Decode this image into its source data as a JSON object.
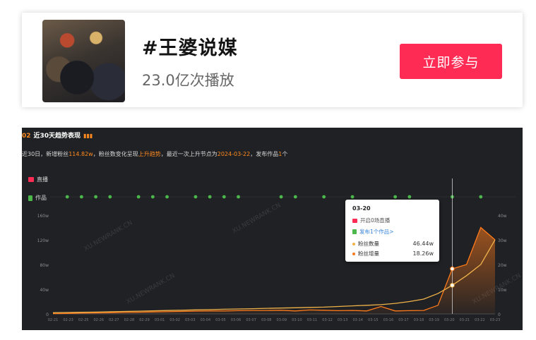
{
  "topic": {
    "title": "#王婆说媒",
    "views": "23.0亿次播放",
    "join_label": "立即参与"
  },
  "trend": {
    "section_number": "02",
    "section_title": "近30天趋势表现",
    "summary": {
      "p1": "近30日，新增粉丝",
      "fans_added": "114.82w",
      "p2": "，粉丝数变化呈现",
      "trend_word": "上升趋势",
      "p3": "，最近一次上升节点为",
      "last_rise": "2024-03-22",
      "p4": "，发布作品",
      "works_count": "1",
      "p5": "个"
    },
    "legend_live": "直播",
    "legend_works": "作品",
    "tooltip": {
      "date": "03-20",
      "live": "开启0场直播",
      "works": "发布1个作品>",
      "fans_label": "粉丝数量",
      "fans_value": "46.44w",
      "inc_label": "粉丝增量",
      "inc_value": "18.26w"
    },
    "watermark": "XU.NEWRANK.CN"
  },
  "chart_data": {
    "type": "line",
    "x": [
      "02-21",
      "02-22",
      "02-23",
      "02-24",
      "02-25",
      "02-26",
      "02-27",
      "02-28",
      "02-29",
      "03-01",
      "03-02",
      "03-03",
      "03-04",
      "03-05",
      "03-06",
      "03-07",
      "03-08",
      "03-09",
      "03-10",
      "03-11",
      "03-12",
      "03-13",
      "03-14",
      "03-15",
      "03-16",
      "03-17",
      "03-18",
      "03-19",
      "03-20",
      "03-21",
      "03-22",
      "03-23"
    ],
    "x_tick_labels": [
      "02-21",
      "02-23",
      "02-25",
      "02-26",
      "02-27",
      "02-28",
      "02-29",
      "03-01",
      "03-02",
      "03-03",
      "03-04",
      "03-05",
      "03-06",
      "03-07",
      "03-08",
      "03-09",
      "03-10",
      "03-11",
      "03-12",
      "03-13",
      "03-14",
      "03-15",
      "03-16",
      "03-17",
      "03-18",
      "03-19",
      "03-20",
      "03-21",
      "03-22",
      "03-23"
    ],
    "y_left_ticks": [
      "160w",
      "120w",
      "80w",
      "40w",
      "0"
    ],
    "y_right_ticks": [
      "40w",
      "30w",
      "20w",
      "10w",
      "0"
    ],
    "ylim_left": [
      0,
      160
    ],
    "ylim_right": [
      0,
      40
    ],
    "series": [
      {
        "name": "粉丝数量",
        "axis": "left",
        "color": "#f0b34a",
        "values": [
          2,
          2.3,
          2.6,
          3,
          3.5,
          4,
          4.5,
          5,
          5.5,
          6,
          6.5,
          7,
          7.5,
          8,
          8.5,
          9,
          9.5,
          10,
          10.5,
          11,
          12,
          13,
          14,
          15,
          17,
          20,
          24,
          33,
          46.44,
          62,
          80,
          120
        ]
      },
      {
        "name": "粉丝增量",
        "axis": "right",
        "color": "#ff7a1a",
        "values": [
          0.1,
          0.2,
          0.3,
          0.4,
          0.5,
          0.6,
          0.7,
          0.8,
          0.9,
          1.0,
          1.1,
          1.2,
          1.2,
          1.3,
          1.4,
          1.4,
          1.5,
          1.2,
          1.6,
          1.5,
          1.3,
          1.4,
          1.2,
          3.0,
          1.2,
          1.3,
          1.4,
          3.5,
          18.26,
          20,
          35,
          30
        ]
      }
    ],
    "works_markers": [
      "02-22",
      "02-23",
      "02-24",
      "02-25",
      "02-27",
      "02-28",
      "02-29",
      "03-02",
      "03-03",
      "03-04",
      "03-05",
      "03-08",
      "03-09",
      "03-11",
      "03-13",
      "03-16",
      "03-17",
      "03-20",
      "03-22"
    ],
    "highlight": "03-20"
  }
}
